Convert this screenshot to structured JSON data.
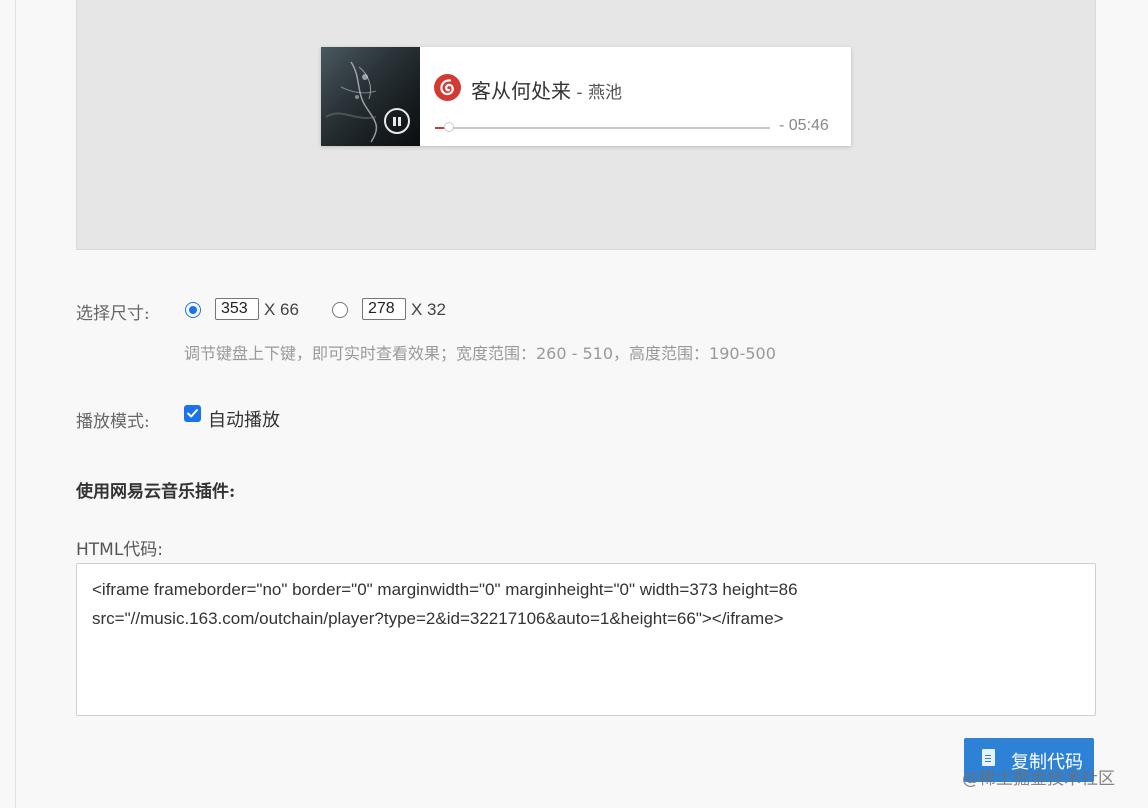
{
  "player": {
    "title": "客从何处来",
    "separator": " - ",
    "artist": "燕池",
    "time": "- 05:46",
    "progress": 0.03
  },
  "size_setting": {
    "label": "选择尺寸:",
    "option1_width": "353",
    "option1_height": "X 66",
    "option2_width": "278",
    "option2_height": "X 32",
    "selected": 1,
    "hint": "调节键盘上下键，即可实时查看效果；宽度范围：260 - 510，高度范围：190-500"
  },
  "play_mode": {
    "label": "播放模式:",
    "autoplay_label": "自动播放",
    "autoplay_checked": true
  },
  "plugin": {
    "title": "使用网易云音乐插件:",
    "code_label": "HTML代码:",
    "code": "<iframe frameborder=\"no\" border=\"0\" marginwidth=\"0\" marginheight=\"0\" width=373 height=86\nsrc=\"//music.163.com/outchain/player?type=2&id=32217106&auto=1&height=66\"></iframe>",
    "copy_label": "复制代码"
  },
  "watermark": "@稀土掘金技术社区",
  "colors": {
    "accent": "#1a73e8",
    "netease_red": "#d33a31",
    "copy_button": "#2e82d6"
  }
}
